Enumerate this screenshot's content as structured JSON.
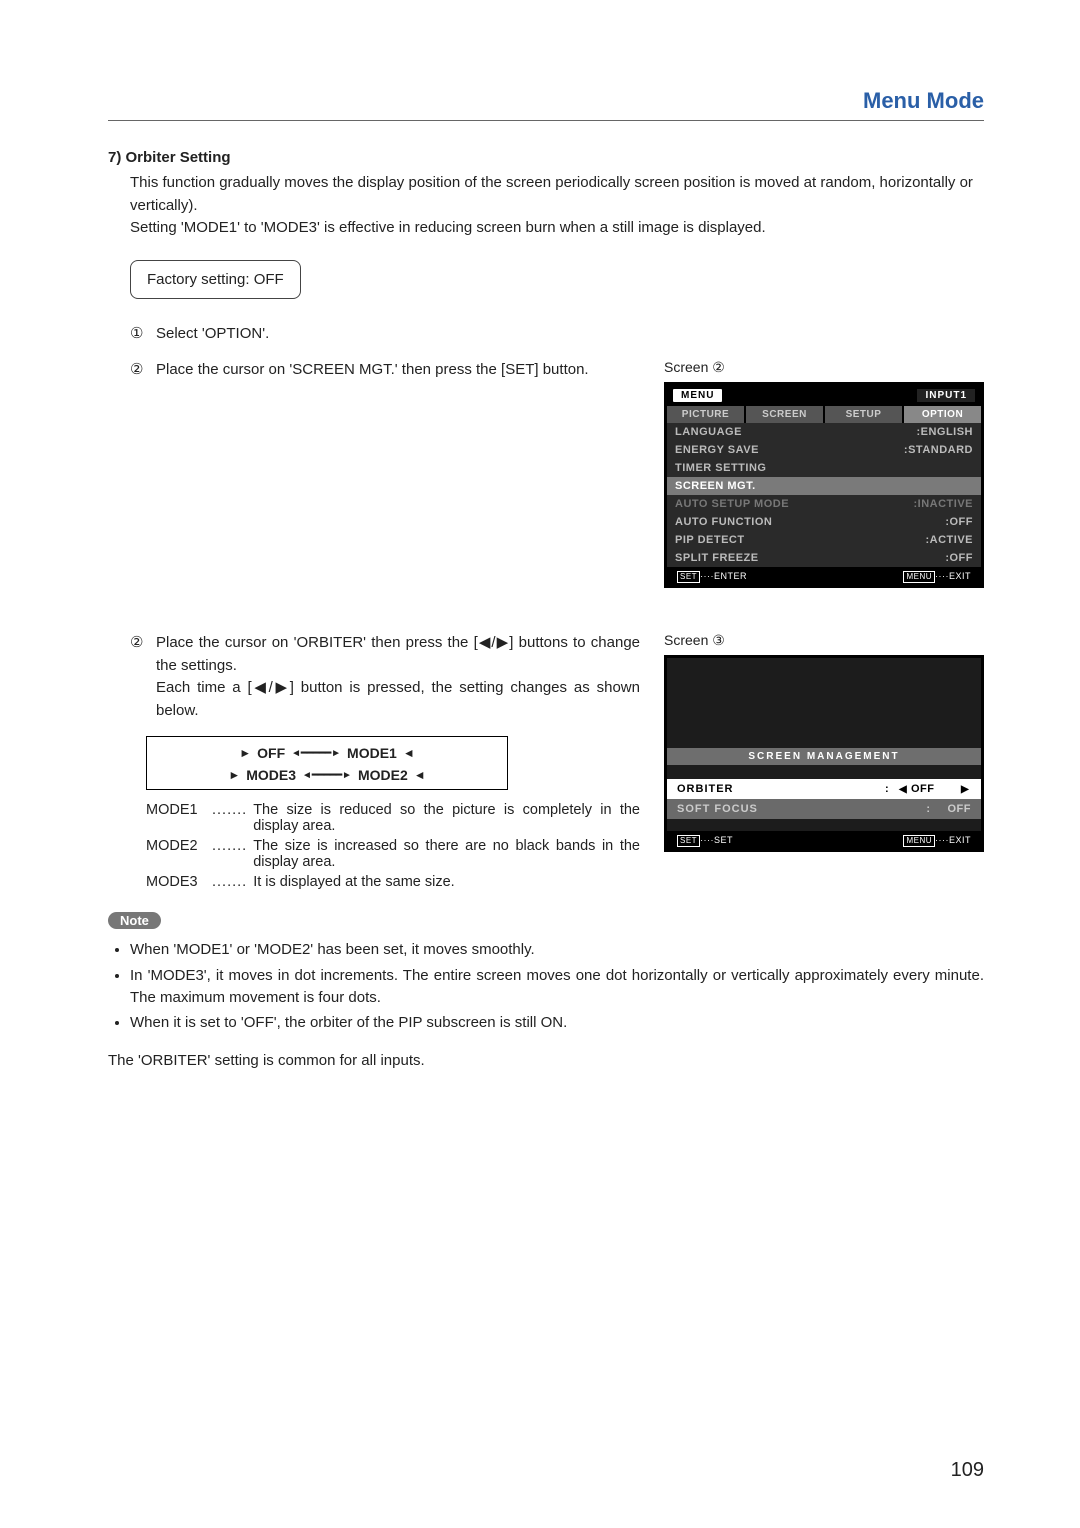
{
  "chapter_title": "Menu Mode",
  "section_number": "7)",
  "section_title": "Orbiter Setting",
  "intro1": "This function gradually moves the display position of the screen periodically screen position is moved at random, horizontally or vertically).",
  "intro2": "Setting 'MODE1' to 'MODE3' is effective in reducing screen burn when a still image is displayed.",
  "factory": "Factory setting: OFF",
  "step1_num": "①",
  "step1_text": "Select 'OPTION'.",
  "step2_num": "②",
  "step2_text": "Place the cursor on 'SCREEN MGT.' then press the [SET] button.",
  "screen2_label": "Screen ②",
  "osd1": {
    "menu_pill": "MENU",
    "input_pill": "INPUT1",
    "tabs": [
      "PICTURE",
      "SCREEN",
      "SETUP",
      "OPTION"
    ],
    "items": [
      {
        "label": "LANGUAGE",
        "value": ":ENGLISH",
        "cls": ""
      },
      {
        "label": "ENERGY SAVE",
        "value": ":STANDARD",
        "cls": ""
      },
      {
        "label": "TIMER SETTING",
        "value": "",
        "cls": ""
      },
      {
        "label": "SCREEN MGT.",
        "value": "",
        "cls": "hl"
      },
      {
        "label": "AUTO SETUP MODE",
        "value": ":INACTIVE",
        "cls": "dim"
      },
      {
        "label": "AUTO FUNCTION",
        "value": ":OFF",
        "cls": ""
      },
      {
        "label": "PIP DETECT",
        "value": ":ACTIVE",
        "cls": ""
      },
      {
        "label": "SPLIT FREEZE",
        "value": ":OFF",
        "cls": ""
      }
    ],
    "foot_left_key": "SET",
    "foot_left_text": "····ENTER",
    "foot_right_key": "MENU",
    "foot_right_text": "····EXIT"
  },
  "step3_num": "②",
  "step3_text1": "Place the cursor on 'ORBITER' then press the [◀/▶] buttons to change the settings.",
  "step3_text2": "Each time a [◀/▶] button is pressed, the setting changes as shown below.",
  "cycle": {
    "top_left": "OFF",
    "top_right": "MODE1",
    "bottom_left": "MODE3",
    "bottom_right": "MODE2"
  },
  "mode_defs": [
    {
      "name": "MODE1",
      "dots": ".......",
      "desc": "The size is reduced so the picture is completely in the display area."
    },
    {
      "name": "MODE2",
      "dots": ".......",
      "desc": "The size is increased so there are no black bands in the display area."
    },
    {
      "name": "MODE3",
      "dots": ".......",
      "desc": "It is displayed at the same size."
    }
  ],
  "screen3_label": "Screen ③",
  "osd2": {
    "title": "SCREEN MANAGEMENT",
    "row1": {
      "label": "ORBITER",
      "colon": ":",
      "left_arrow": "◀",
      "value": "OFF",
      "right_arrow": "▶"
    },
    "row2": {
      "label": "SOFT FOCUS",
      "colon": ":",
      "value": "  OFF"
    },
    "foot_left_key": "SET",
    "foot_left_text": "····SET",
    "foot_right_key": "MENU",
    "foot_right_text": "····EXIT"
  },
  "note_label": "Note",
  "notes": [
    "When 'MODE1' or 'MODE2' has been set, it moves smoothly.",
    "In 'MODE3', it moves in dot increments. The entire screen moves one dot horizontally or vertically approximately every minute. The maximum movement is four dots.",
    "When it is set to 'OFF', the orbiter of the PIP subscreen is still ON."
  ],
  "final": "The 'ORBITER' setting is common for all inputs.",
  "page_number": "109"
}
